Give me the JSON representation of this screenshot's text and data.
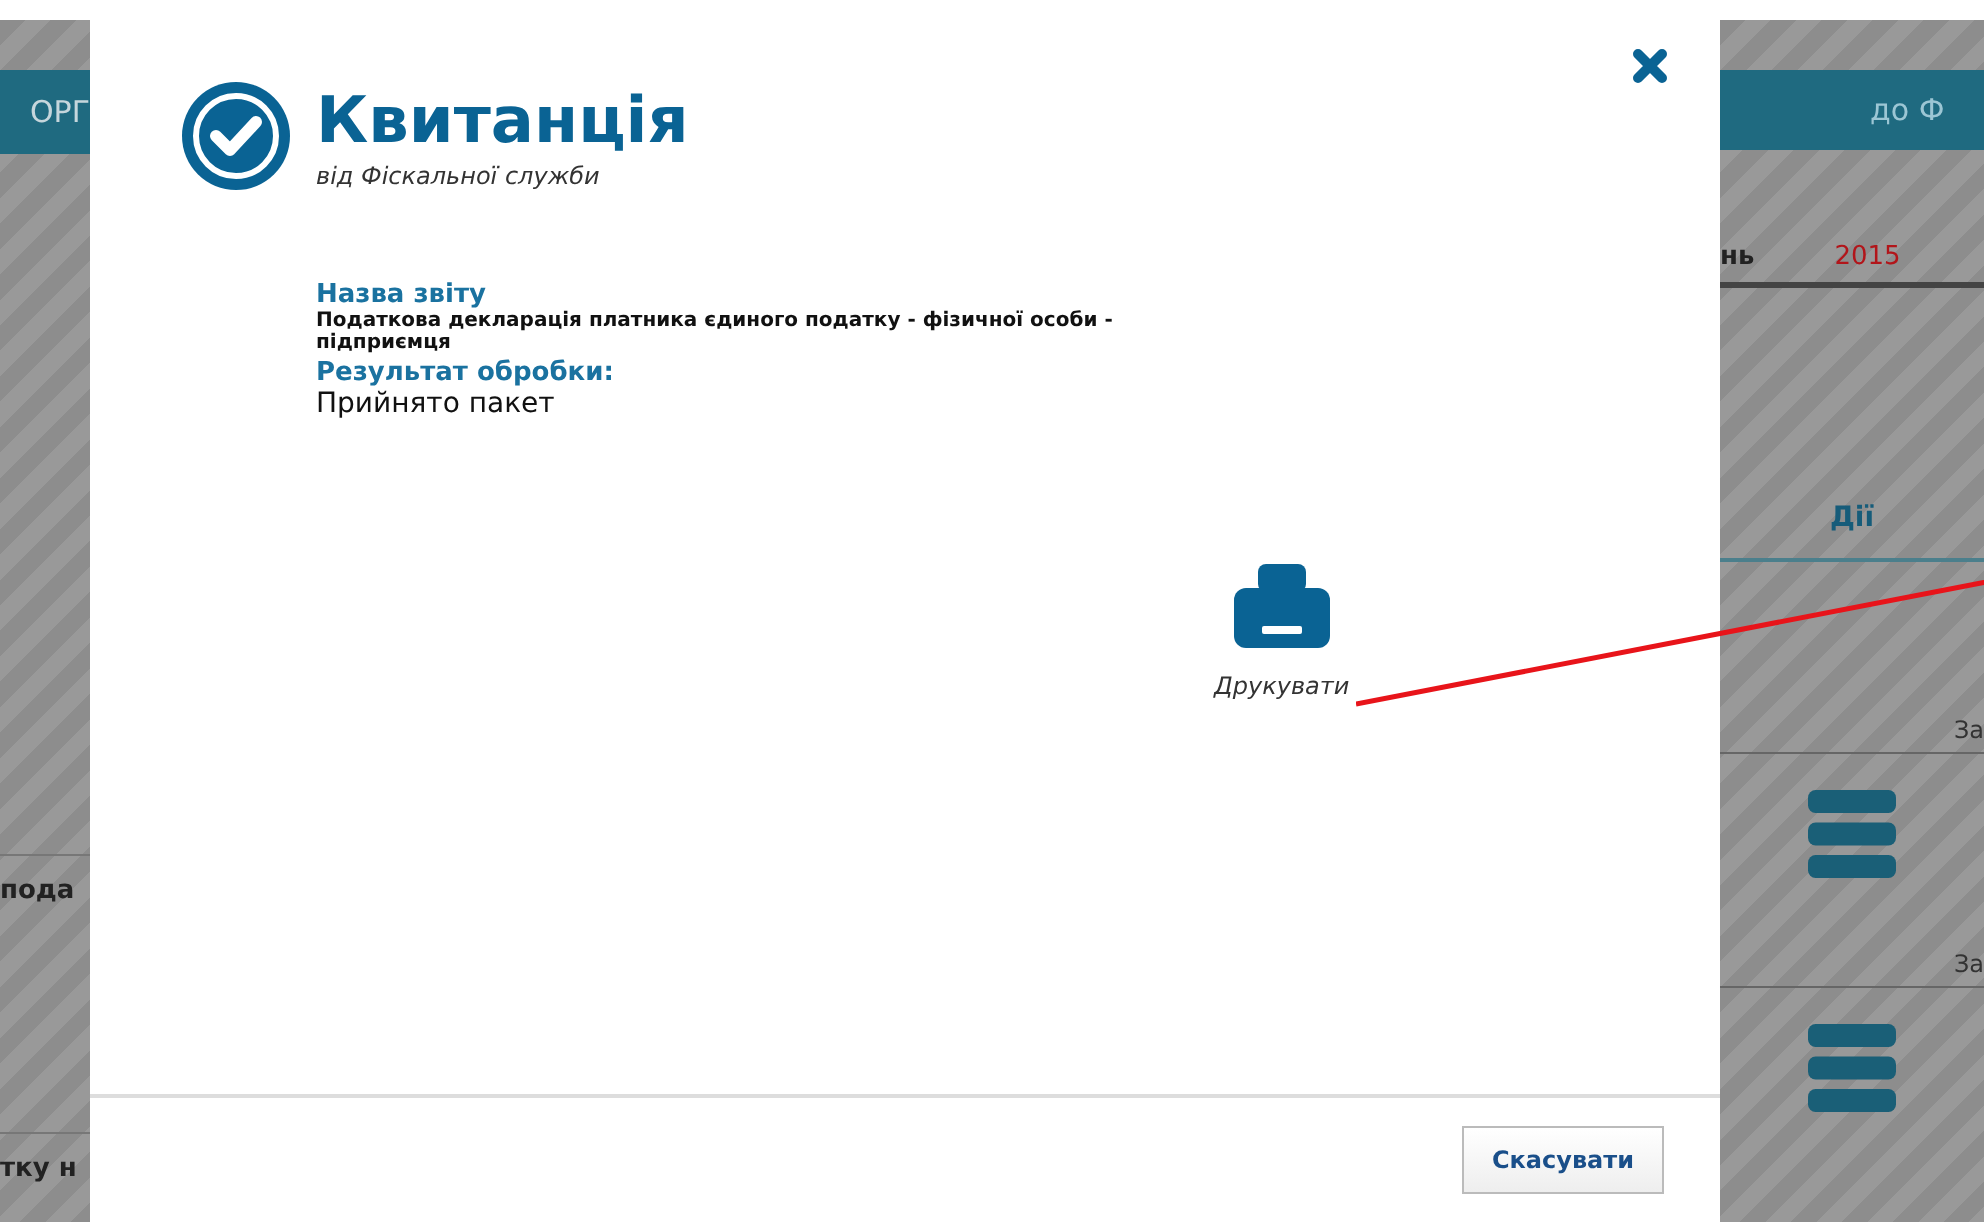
{
  "background": {
    "left": {
      "banner": "ОРГ",
      "rows": [
        "пода",
        "тку н"
      ]
    },
    "right": {
      "banner": "до Ф",
      "period_label": "нь",
      "year": "2015",
      "column_header": "Дії",
      "rows": [
        "За",
        "За"
      ]
    }
  },
  "dialog": {
    "title": "Квитанція",
    "subtitle": "від Фіскальної служби",
    "fields": [
      {
        "label": "Назва звіту",
        "value": "Податкова декларація платника єдиного податку - фізичної особи - підприємця",
        "kind": "bold"
      },
      {
        "label": "Результат обробки:",
        "value": "Прийнято пакет",
        "kind": "plain"
      }
    ],
    "print_label": "Друкувати",
    "cancel_button": "Скасувати"
  }
}
